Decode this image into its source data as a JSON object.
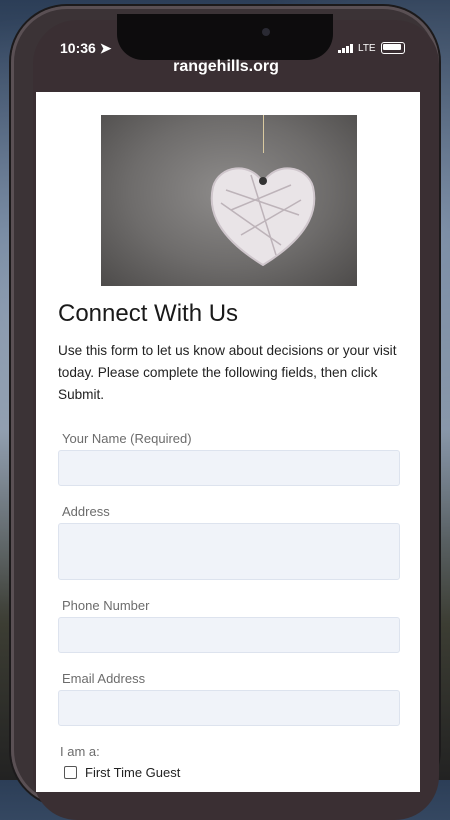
{
  "status": {
    "time": "10:36",
    "network": "LTE"
  },
  "browser": {
    "url": "rangehills.org"
  },
  "page": {
    "title": "Connect With Us",
    "intro": "Use this form to let us know about decisions or your visit today. Please complete the following fields, then click Submit."
  },
  "form": {
    "name_label": "Your Name (Required)",
    "address_label": "Address",
    "phone_label": "Phone Number",
    "email_label": "Email Address",
    "iam_label": "I am a:",
    "option_first_time": "First Time Guest"
  }
}
